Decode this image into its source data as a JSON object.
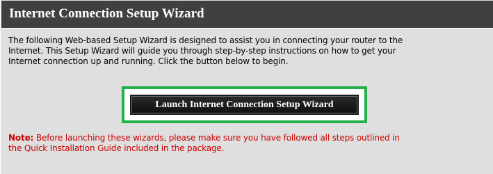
{
  "wizard": {
    "title": "Internet Connection Setup Wizard",
    "intro_lines": [
      "The following Web-based Setup Wizard is designed to assist you in connecting your router to the",
      "Internet. This Setup Wizard will guide you through step-by-step instructions on how to get your",
      "Internet connection up and running. Click the button below to begin."
    ],
    "launch_button_label": "Launch Internet Connection Setup Wizard",
    "note": {
      "label": "Note:",
      "line1": " Before launching these wizards, please make sure you have followed all steps outlined in",
      "line2": "the Quick Installation Guide included in the package."
    }
  },
  "colors": {
    "header_bg": "#404040",
    "panel_bg": "#dfdfdf",
    "highlight_frame": "#22b04b",
    "note_text": "#cc0000",
    "button_bg": "#1a1a1a"
  }
}
